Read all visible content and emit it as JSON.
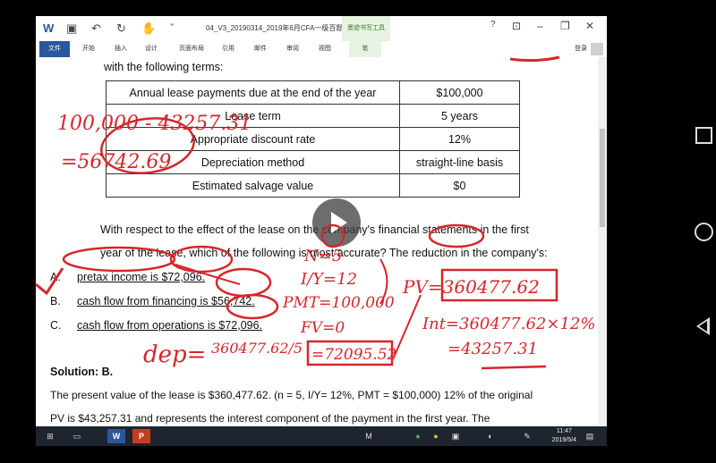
{
  "window": {
    "doc_title": "04_V3_20190314_2019年6月CFA一级百题预...",
    "ink_tools": "墨迹书写工具",
    "ink_tab": "笔",
    "help": "?",
    "login": "登录"
  },
  "ribbon_tabs": [
    "文件",
    "开始",
    "插入",
    "设计",
    "页面布局",
    "引用",
    "邮件",
    "审阅",
    "视图",
    "笔"
  ],
  "document": {
    "intro": "with the following terms:",
    "table": [
      [
        "Annual lease payments due at the end of the year",
        "$100,000"
      ],
      [
        "Lease term",
        "5 years"
      ],
      [
        "Appropriate discount rate",
        "12%"
      ],
      [
        "Depreciation method",
        "straight-line basis"
      ],
      [
        "Estimated salvage value",
        "$0"
      ]
    ],
    "question_line1": "With respect to the effect of the lease on the company's financial statements in the first",
    "question_line2": "year of the lease, which of the following is most accurate? The reduction in the company's:",
    "options": [
      {
        "letter": "A.",
        "text": "pretax income is $72,096."
      },
      {
        "letter": "B.",
        "text": "cash flow from financing is $56,742."
      },
      {
        "letter": "C.",
        "text": "cash flow from operations is $72,096."
      }
    ],
    "solution_label": "Solution: B.",
    "solution_line1": "The present value of the lease is $360,477.62. (n = 5, I/Y= 12%, PMT = $100,000) 12% of the original",
    "solution_line2": "PV is $43,257.31 and represents the interest component of the payment in the first year. The"
  },
  "annotations": {
    "calc1": "100,000 - 43257.31",
    "calc2": "=56742.69",
    "n": "N=5",
    "iy": "I/Y=12",
    "pmt": "PMT=100,000",
    "fv": "FV=0",
    "pv": "PV=360477.62",
    "int1": "Int=360477.62×12%",
    "int2": "=43257.31",
    "dep": "dep=",
    "dep_frac": "360477.62/5",
    "dep_val": "=72095.52"
  },
  "taskbar": {
    "time": "11:47",
    "date": "2019/5/4"
  },
  "colors": {
    "ink": "#d6262a",
    "file_tab": "#2b579a",
    "ink_ctx": "#e7f2e2"
  }
}
